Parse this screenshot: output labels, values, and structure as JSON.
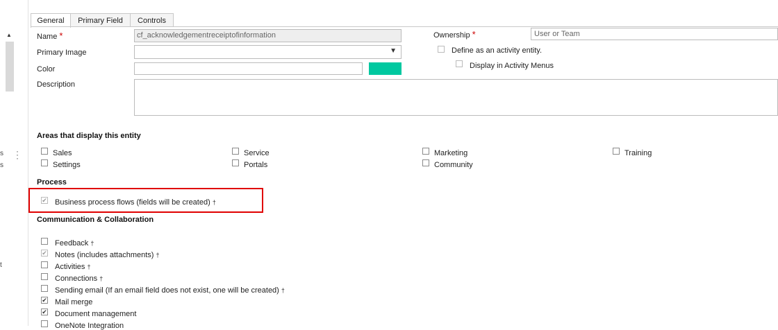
{
  "tabs": [
    {
      "label": "General"
    },
    {
      "label": "Primary Field"
    },
    {
      "label": "Controls"
    }
  ],
  "form": {
    "name_label": "Name",
    "name_value": "cf_acknowledgementreceiptofinformation",
    "primary_image_label": "Primary Image",
    "color_label": "Color",
    "color_swatch": "#00c8a0",
    "description_label": "Description",
    "ownership_label": "Ownership",
    "ownership_value": "User or Team",
    "define_activity_label": "Define as an activity entity.",
    "display_activity_label": "Display in Activity Menus"
  },
  "areas": {
    "title": "Areas that display this entity",
    "items": [
      {
        "label": "Sales",
        "checked": false
      },
      {
        "label": "Settings",
        "checked": false
      },
      {
        "label": "Service",
        "checked": false
      },
      {
        "label": "Portals",
        "checked": false
      },
      {
        "label": "Marketing",
        "checked": false
      },
      {
        "label": "Community",
        "checked": false
      },
      {
        "label": "Training",
        "checked": false
      }
    ]
  },
  "process": {
    "title": "Process",
    "bpf_label": "Business process flows (fields will be created)",
    "bpf_checked": true
  },
  "communication": {
    "title": "Communication & Collaboration",
    "items": [
      {
        "label": "Feedback",
        "checked": false,
        "dagger": "†"
      },
      {
        "label": "Notes (includes attachments)",
        "checked": true,
        "dim": true,
        "dagger": "†"
      },
      {
        "label": "Activities",
        "checked": false,
        "dagger": "†"
      },
      {
        "label": "Connections",
        "checked": false,
        "dagger": "†"
      },
      {
        "label": "Sending email (If an email field does not exist, one will be created)",
        "checked": false,
        "dagger": "†"
      },
      {
        "label": "Mail merge",
        "checked": true,
        "dagger": ""
      },
      {
        "label": "Document management",
        "checked": true,
        "dagger": ""
      },
      {
        "label": "OneNote Integration",
        "checked": false,
        "dagger": ""
      }
    ]
  },
  "left_fragments": [
    "s",
    "s",
    "t"
  ],
  "highlight_color": "#e00000"
}
